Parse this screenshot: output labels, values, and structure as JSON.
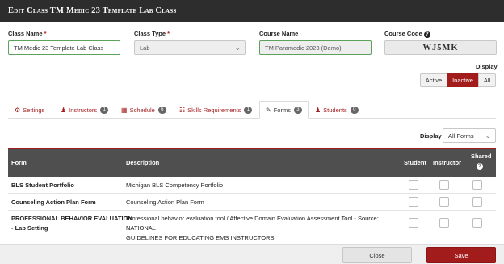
{
  "dialog": {
    "title": "Edit Class TM Medic 23 Template Lab Class"
  },
  "fields": {
    "class_name": {
      "label": "Class Name",
      "required_mark": "*",
      "value": "TM Medic 23 Template Lab Class"
    },
    "class_type": {
      "label": "Class Type",
      "required_mark": "*",
      "value": "Lab"
    },
    "course_name": {
      "label": "Course Name",
      "value": "TM Paramedic 2023 (Demo)"
    },
    "course_code": {
      "label": "Course Code",
      "value": "WJ5MK"
    }
  },
  "display_filter": {
    "label": "Display",
    "options": [
      "Active",
      "Inactive",
      "All"
    ],
    "selected": "Inactive"
  },
  "tabs": [
    {
      "label": "Settings",
      "icon": "gear-icon"
    },
    {
      "label": "Instructors",
      "icon": "user-icon",
      "count": "1"
    },
    {
      "label": "Schedule",
      "icon": "calendar-icon",
      "count": "6"
    },
    {
      "label": "Skills Requirements",
      "icon": "sitemap-icon",
      "count": "1"
    },
    {
      "label": "Forms",
      "icon": "pencil-icon",
      "count": "3",
      "selected": true
    },
    {
      "label": "Students",
      "icon": "user-icon",
      "count": "0"
    }
  ],
  "forms_display": {
    "label": "Display",
    "value": "All Forms"
  },
  "table": {
    "headers": {
      "form": "Form",
      "description": "Description",
      "student": "Student",
      "instructor": "Instructor",
      "shared": "Shared"
    },
    "rows": [
      {
        "form": "BLS Student Portfolio",
        "description": "Michigan BLS Competency Portfolio"
      },
      {
        "form": "Counseling Action Plan Form",
        "description": "Counseling Action Plan Form"
      },
      {
        "form_line1": "PROFESSIONAL BEHAVIOR EVALUATION",
        "form_line2": "- Lab Setting",
        "desc_line1": "Professional behavior evaluation tool / Affective Domain Evaluation Assessment Tool -  Source: NATIONAL",
        "desc_line2": "GUIDELINES FOR EDUCATING EMS INSTRUCTORS"
      }
    ]
  },
  "footer": {
    "close_label": "Close",
    "save_label": "Save"
  },
  "colors": {
    "accent": "#a21c1c",
    "header_bar": "#2d2d2d",
    "table_header": "#4f4f4f",
    "field_border_valid": "#5aa35a"
  }
}
